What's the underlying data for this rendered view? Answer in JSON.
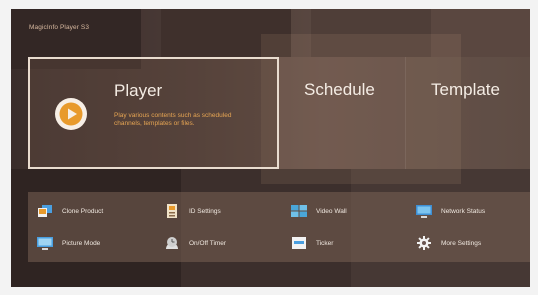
{
  "app": {
    "title": "MagicInfo Player S3"
  },
  "main_menu": {
    "player": {
      "label": "Player",
      "description": "Play various contents such as scheduled channels, templates or files."
    },
    "schedule": {
      "label": "Schedule"
    },
    "template": {
      "label": "Template"
    }
  },
  "tools": [
    {
      "label": "Clone Product",
      "icon": "clone-product-icon"
    },
    {
      "label": "ID Settings",
      "icon": "id-settings-icon"
    },
    {
      "label": "Video Wall",
      "icon": "video-wall-icon"
    },
    {
      "label": "Network Status",
      "icon": "network-status-icon"
    },
    {
      "label": "Picture Mode",
      "icon": "picture-mode-icon"
    },
    {
      "label": "On/Off Timer",
      "icon": "timer-icon"
    },
    {
      "label": "Ticker",
      "icon": "ticker-icon"
    },
    {
      "label": "More Settings",
      "icon": "gear-icon"
    }
  ],
  "colors": {
    "accent_orange": "#e89a2c",
    "focus_border": "#e9dccf",
    "text_light": "#f4ece4"
  }
}
